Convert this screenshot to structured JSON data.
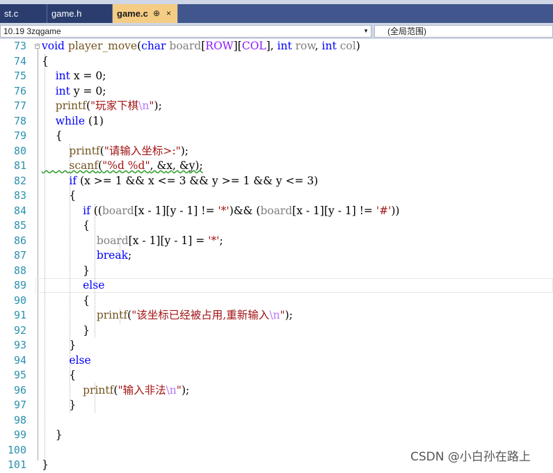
{
  "tabs": [
    {
      "label": "st.c",
      "active": false
    },
    {
      "label": "game.h",
      "active": false
    },
    {
      "label": "game.c",
      "active": true,
      "pin_icon": "⊕",
      "close_icon": "×"
    }
  ],
  "navbar": {
    "project": "10.19 3zqgame",
    "scope": "(全局范围)"
  },
  "editor": {
    "line_numbers": [
      "73",
      "74",
      "75",
      "76",
      "77",
      "78",
      "79",
      "80",
      "81",
      "82",
      "83",
      "84",
      "85",
      "86",
      "87",
      "88",
      "89",
      "90",
      "91",
      "92",
      "93",
      "94",
      "95",
      "96",
      "97",
      "98",
      "99",
      "100",
      "101"
    ],
    "lines": [
      "void player_move(char board[ROW][COL], int row, int col)",
      "{",
      "    int x = 0;",
      "    int y = 0;",
      "    printf(\"玩家下棋\\n\");",
      "    while (1)",
      "    {",
      "        printf(\"请输入坐标>:\");",
      "        scanf(\"%d %d\", &x, &y);",
      "        if (x >= 1 && x <= 3 && y >= 1 && y <= 3)",
      "        {",
      "            if ((board[x - 1][y - 1] != '*')&& (board[x - 1][y - 1] != '#'))",
      "            {",
      "                board[x - 1][y - 1] = '*';",
      "                break;",
      "            }",
      "            else",
      "            {",
      "                printf(\"该坐标已经被占用,重新输入\\n\");",
      "            }",
      "        }",
      "        else",
      "        {",
      "            printf(\"输入非法\\n\");",
      "        }",
      "",
      "    }",
      "",
      "}"
    ]
  },
  "colors": {
    "keyword": "#0000ff",
    "function": "#74531f",
    "string": "#a31515",
    "escape": "#b776fb",
    "parameter": "#808080",
    "macro": "#8a1bff",
    "line_number": "#2b91af",
    "tab_active": "#f5cc84",
    "tab_strip": "#40568d"
  },
  "watermark": "CSDN @小白孙在路上"
}
